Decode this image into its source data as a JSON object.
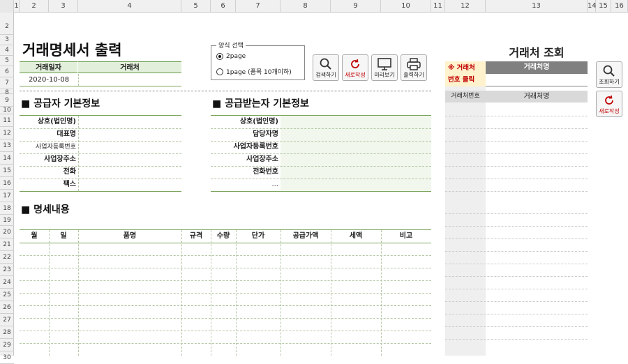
{
  "columns": [
    "1",
    "2",
    "3",
    "4",
    "5",
    "6",
    "7",
    "8",
    "9",
    "10",
    "11",
    "12",
    "13",
    "14",
    "15",
    "16"
  ],
  "rows": [
    "2",
    "3",
    "4",
    "5",
    "6",
    "7",
    "8",
    "9",
    "10",
    "11",
    "12",
    "13",
    "14",
    "15",
    "16",
    "17",
    "18",
    "19",
    "20",
    "21",
    "22",
    "23",
    "24",
    "25",
    "26",
    "27",
    "28",
    "29",
    "30"
  ],
  "title": "거래명세서 출력",
  "header_table": {
    "date_label": "거래일자",
    "client_label": "거래처",
    "date_value": "2020-10-08"
  },
  "form": {
    "legend": "양식 선택",
    "opt1": "2page",
    "opt2": "1page (품목 10개이하)",
    "selected": "2page"
  },
  "toolbar": {
    "search": "검색하기",
    "new": "새로작성",
    "preview": "미리보기",
    "print": "출력하기"
  },
  "supplier": {
    "heading": "■ 공급자 기본정보",
    "labels": [
      "상호(법인명)",
      "대표명",
      "사업자등록번호",
      "사업장주소",
      "전화",
      "팩스"
    ]
  },
  "receiver": {
    "heading": "■ 공급받는자 기본정보",
    "labels": [
      "상호(법인명)",
      "담당자명",
      "사업자등록번호",
      "사업장주소",
      "전화번호",
      "..."
    ]
  },
  "detail": {
    "heading": "■ 명세내용",
    "columns": [
      "월",
      "일",
      "품명",
      "규격",
      "수량",
      "단가",
      "공급가액",
      "세액",
      "비고"
    ]
  },
  "lookup": {
    "title": "거래처 조회",
    "note_line1": "※ 거래처",
    "note_line2": "번호 클릭",
    "name_header": "거래처명",
    "list_col1": "거래처번호",
    "list_col2": "거래처명",
    "btn_lookup": "조회하기",
    "btn_new": "새로작성"
  },
  "colors": {
    "accent_green": "#7aa35a",
    "header_green": "#e2efda",
    "note_red": "#c00000",
    "note_yellow": "#fff2cc",
    "gray_header": "#808080"
  }
}
